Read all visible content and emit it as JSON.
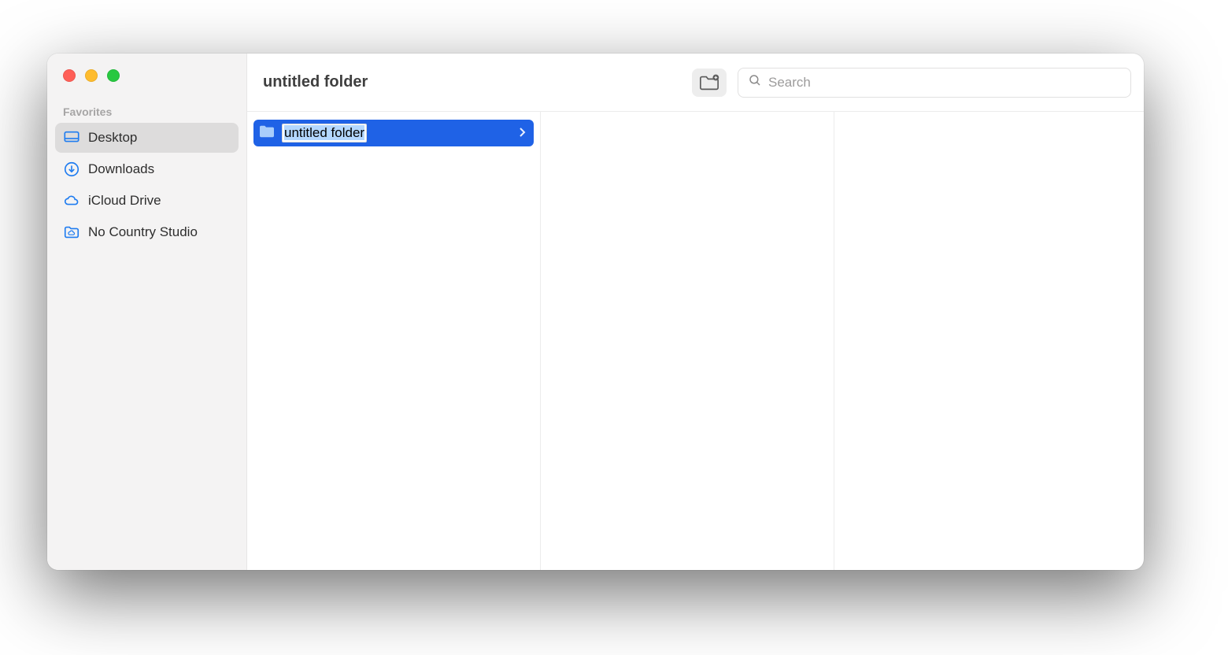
{
  "window": {
    "title": "untitled folder"
  },
  "toolbar": {
    "search_placeholder": "Search"
  },
  "sidebar": {
    "section_label": "Favorites",
    "items": [
      {
        "id": "desktop",
        "label": "Desktop",
        "icon": "desktop",
        "active": true
      },
      {
        "id": "downloads",
        "label": "Downloads",
        "icon": "download",
        "active": false
      },
      {
        "id": "icloud",
        "label": "iCloud Drive",
        "icon": "cloud",
        "active": false
      },
      {
        "id": "ncs",
        "label": "No Country Studio",
        "icon": "cloud-box",
        "active": false
      }
    ]
  },
  "columns": [
    {
      "items": [
        {
          "name": "untitled folder",
          "type": "folder",
          "selected": true,
          "renaming": true
        }
      ]
    },
    {
      "items": []
    },
    {
      "items": []
    }
  ],
  "colors": {
    "selection": "#1f62e6",
    "accent": "#1f7cf0",
    "sidebar_bg": "#f4f3f3"
  }
}
